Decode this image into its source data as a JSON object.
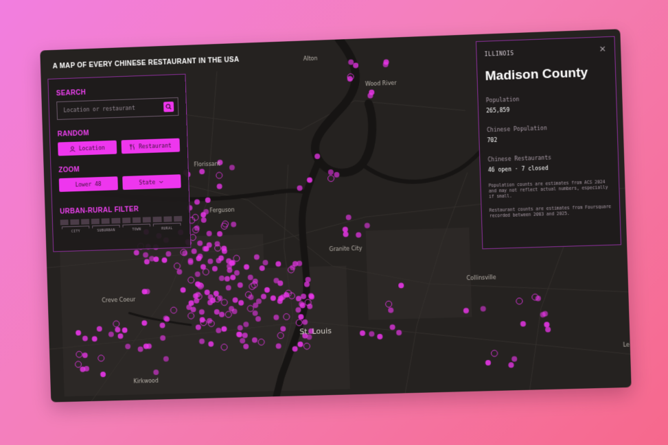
{
  "app": {
    "title": "A MAP OF EVERY CHINESE RESTAURANT IN THE USA"
  },
  "search": {
    "label": "SEARCH",
    "placeholder": "Location or restaurant",
    "icon": "search-icon"
  },
  "random": {
    "label": "RANDOM",
    "buttons": [
      {
        "icon": "person-icon",
        "label": "Location"
      },
      {
        "icon": "utensils-icon",
        "label": "Restaurant"
      }
    ]
  },
  "zoom": {
    "label": "ZOOM",
    "buttons": [
      {
        "label": "Lower 48"
      },
      {
        "label": "State",
        "icon": "chevron-down-icon"
      }
    ]
  },
  "filter": {
    "label": "URBAN-RURAL FILTER",
    "categories": [
      "CITY",
      "SUBURBAN",
      "TOWN",
      "RURAL"
    ]
  },
  "detail": {
    "state": "ILLINOIS",
    "county": "Madison County",
    "stats": [
      {
        "label": "Population",
        "value": "265,859"
      },
      {
        "label": "Chinese Population",
        "value": "702"
      },
      {
        "label": "Chinese Restaurants",
        "value": "46 open · 7 closed"
      }
    ],
    "notes": [
      "Population counts are estimates from ACS 2024 and may not reflect actual numbers, especially if small.",
      "Restaurant counts are estimates from Foursquare recorded between 2003 and 2025."
    ]
  },
  "map": {
    "places": [
      {
        "name": "Alton"
      },
      {
        "name": "Wood River"
      },
      {
        "name": "Florissant"
      },
      {
        "name": "Ferguson"
      },
      {
        "name": "Granite City"
      },
      {
        "name": "Collinsville"
      },
      {
        "name": "Creve Coeur"
      },
      {
        "name": "St. Louis"
      },
      {
        "name": "Kirkwood"
      },
      {
        "name": "Leb"
      }
    ]
  },
  "colors": {
    "accent": "#ee36ee",
    "map_background": "#252220",
    "river": "#141212",
    "panel_border": "#8b2f9a"
  }
}
